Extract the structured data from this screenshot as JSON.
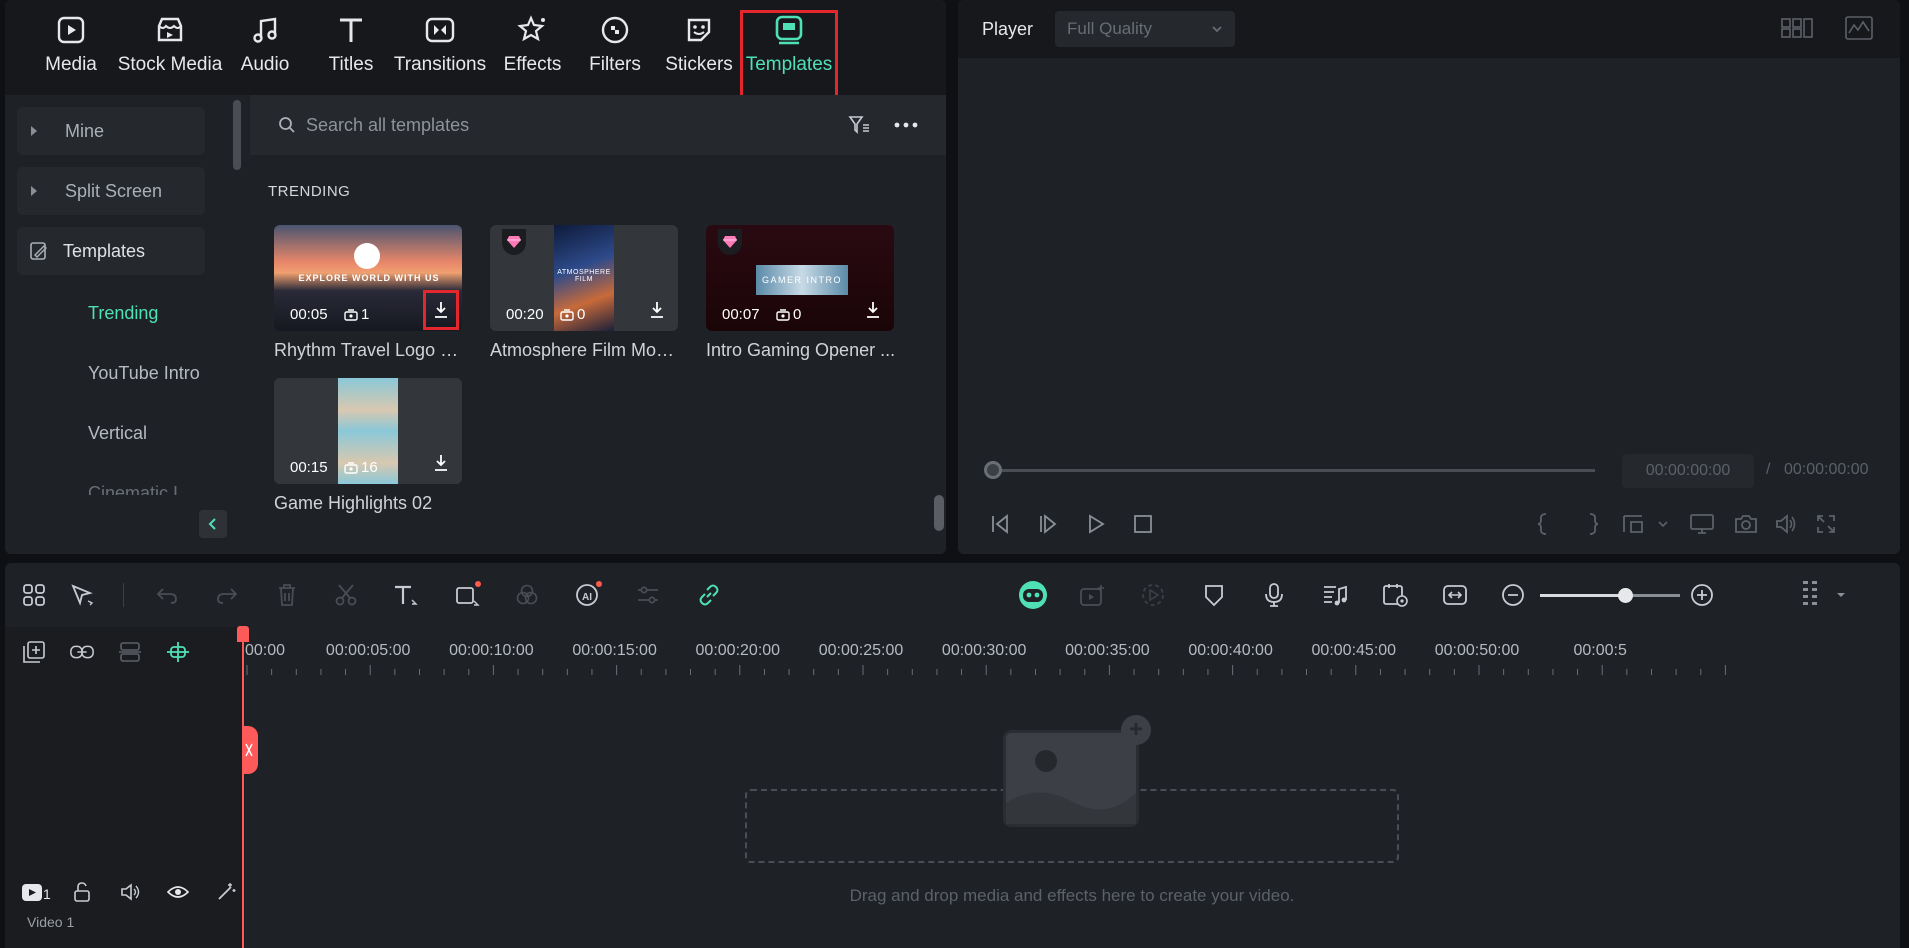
{
  "tabs": [
    {
      "label": "Media",
      "icon": "media-icon"
    },
    {
      "label": "Stock Media",
      "icon": "stock-media-icon"
    },
    {
      "label": "Audio",
      "icon": "audio-icon"
    },
    {
      "label": "Titles",
      "icon": "titles-icon"
    },
    {
      "label": "Transitions",
      "icon": "transitions-icon"
    },
    {
      "label": "Effects",
      "icon": "effects-icon"
    },
    {
      "label": "Filters",
      "icon": "filters-icon"
    },
    {
      "label": "Stickers",
      "icon": "stickers-icon"
    },
    {
      "label": "Templates",
      "icon": "templates-icon",
      "active": true
    }
  ],
  "sidebar": {
    "groups": [
      {
        "label": "Mine"
      },
      {
        "label": "Split Screen"
      },
      {
        "label": "Templates"
      }
    ],
    "sub_items": [
      {
        "label": "Trending",
        "active": true
      },
      {
        "label": "YouTube Intro"
      },
      {
        "label": "Vertical"
      },
      {
        "label": "Cinematic I"
      }
    ]
  },
  "search": {
    "placeholder": "Search all templates"
  },
  "section_title": "TRENDING",
  "templates": [
    {
      "title": "Rhythm Travel Logo R...",
      "duration": "00:05",
      "count": "1",
      "premium": false,
      "overlay_text": "EXPLORE WORLD WITH US"
    },
    {
      "title": "Atmosphere Film Mob...",
      "duration": "00:20",
      "count": "0",
      "premium": true,
      "overlay_text": "ATMOSPHERE FILM"
    },
    {
      "title": "Intro Gaming Opener ...",
      "duration": "00:07",
      "count": "0",
      "premium": true,
      "overlay_text": "GAMER INTRO"
    },
    {
      "title": "Game Highlights 02",
      "duration": "00:15",
      "count": "16",
      "premium": false
    }
  ],
  "player": {
    "title": "Player",
    "quality": "Full Quality",
    "current_time": "00:00:00:00",
    "separator": "/",
    "total_time": "00:00:00:00"
  },
  "timeline": {
    "ruler": [
      "00:00",
      "00:00:05:00",
      "00:00:10:00",
      "00:00:15:00",
      "00:00:20:00",
      "00:00:25:00",
      "00:00:30:00",
      "00:00:35:00",
      "00:00:40:00",
      "00:00:45:00",
      "00:00:50:00",
      "00:00:5"
    ],
    "video_track": {
      "label": "Video 1",
      "index": "1"
    },
    "audio_track": {
      "index": "1"
    },
    "drop_text": "Drag and drop media and effects here to create your video.",
    "zoom_level": 0.6
  },
  "colors": {
    "accent": "#4fe0b6",
    "highlight": "#e4262d",
    "playhead": "#ff5a5a"
  }
}
